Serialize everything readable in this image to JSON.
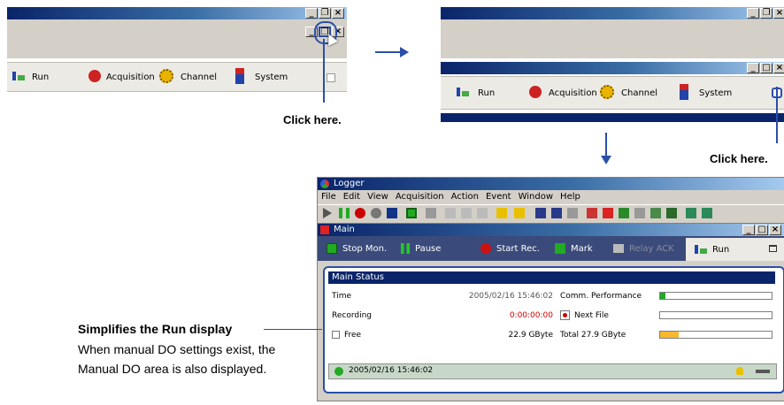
{
  "panel1": {
    "tabs": [
      "Run",
      "Acquisition",
      "Channel",
      "System"
    ],
    "callout": "Click here."
  },
  "panel2": {
    "tabs": [
      "Run",
      "Acquisition",
      "Channel",
      "System"
    ],
    "callout": "Click here."
  },
  "logger": {
    "title": "Logger",
    "menu": [
      "File",
      "Edit",
      "View",
      "Acquisition",
      "Action",
      "Event",
      "Window",
      "Help"
    ],
    "subwindow_title": "Main",
    "actions": {
      "stop_mon": "Stop Mon.",
      "pause": "Pause",
      "start_rec": "Start Rec.",
      "mark": "Mark",
      "relay_ack": "Relay ACK",
      "run": "Run"
    },
    "status": {
      "header": "Main Status",
      "time_label": "Time",
      "time_value": "2005/02/16 15:46:02",
      "comm_label": "Comm. Performance",
      "recording_label": "Recording",
      "recording_value": "0:00:00:00",
      "next_file_label": "Next File",
      "free_label": "Free",
      "free_value": "22.9 GByte",
      "total_label": "Total 27.9 GByte",
      "comm_level": 0.05,
      "total_level": 0.17
    },
    "footer_time": "2005/02/16 15:46:02"
  },
  "annotation": {
    "title": "Simplifies the Run display",
    "body": "When manual DO settings exist, the Manual DO area is also displayed."
  },
  "colors": {
    "accent_blue": "#2b4fa8",
    "status_header": "#0a246a",
    "recording_red": "#cc0000",
    "level_green": "#22aa22",
    "level_orange": "#f5b82e"
  }
}
